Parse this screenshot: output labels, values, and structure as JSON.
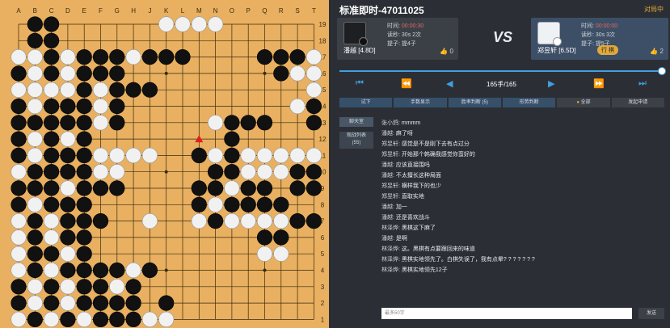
{
  "board": {
    "columns": [
      "A",
      "B",
      "C",
      "D",
      "E",
      "F",
      "G",
      "H",
      "J",
      "K",
      "L",
      "M",
      "N",
      "O",
      "P",
      "Q",
      "R",
      "S",
      "T"
    ],
    "rows": [
      "19",
      "18",
      "17",
      "16",
      "15",
      "14",
      "13",
      "12",
      "11",
      "10",
      "9",
      "8",
      "7",
      "6",
      "5",
      "4",
      "3",
      "2",
      "1"
    ],
    "stones": [
      ".xx......oooo......",
      ".xx.................",
      "ooxoxxxoxxx....xxxo..",
      "xoxoxxx.........xooo..",
      "ooooxoxxx.........ooox",
      "xoxxxox..........ox..x",
      "xxxxxox.....oxxx..xox",
      "xoxox........x.......",
      "xoxxxoooo..xoxoooooo.",
      "oxxxxoo.....xxoooxxo.",
      "xxxoxxx....xxoxx.xxx.",
      "xoxxx......xoxxxx....",
      "oxoxxx..o..oxooooxx..",
      "oxoxx..........xx....",
      "oxxox..........oo....",
      "oxoxxxxox.............",
      "xoxoxxox...........xo.",
      "xoxoxxxx.x...........",
      "oxoxoxxxoo..........."
    ],
    "last_move_marker": "red-triangle"
  },
  "header": {
    "title": "标准即时-47011025",
    "exit_label": "对局中"
  },
  "players": {
    "black": {
      "name": "潘越 [4.8D]",
      "time_label": "时间:",
      "time_value": "00:00:30",
      "byoyomi_label": "读秒:",
      "byoyomi_value": "30s 2次",
      "captures_label": "提子:",
      "captures_value": "提4子",
      "likes": "0"
    },
    "white": {
      "name": "郑昱轩 [6.5D]",
      "time_label": "时间:",
      "time_value": "00:00:00",
      "byoyomi_label": "读秒:",
      "byoyomi_value": "30s 3次",
      "captures_label": "提子:",
      "captures_value": "提5子",
      "badge": "行 棋",
      "likes": "2"
    }
  },
  "vs_label": "VS",
  "progress": {
    "current": 165,
    "total": 165
  },
  "move_counter": "165手/165",
  "toolbar": [
    "试下",
    "手数显示",
    "胜率判断 (5)",
    "形势判断",
    "全部",
    "发起申请"
  ],
  "side_tabs": {
    "chat": "聊天室",
    "viewers": "观战列表\n(55)"
  },
  "chat": [
    {
      "name": "张小鸽:",
      "msg": "mmmm"
    },
    {
      "name": "潘越:",
      "msg": "麻了呀"
    },
    {
      "name": "郑昱轩:",
      "msg": "感觉是不是刚下去有点过分"
    },
    {
      "name": "郑昱轩:",
      "msg": "开始那个韩确我感觉你蛮好的"
    },
    {
      "name": "潘越:",
      "msg": "应该直接围吗"
    },
    {
      "name": "潘越:",
      "msg": "不太擅长这种局面"
    },
    {
      "name": "郑昱轩:",
      "msg": "横样我下的也少"
    },
    {
      "name": "郑昱轩:",
      "msg": "直取实地"
    },
    {
      "name": "潘越:",
      "msg": "加一"
    },
    {
      "name": "潘越:",
      "msg": "还是喜欢战斗"
    },
    {
      "name": "林泽烨:",
      "msg": "黑棋这下麻了"
    },
    {
      "name": "潘越:",
      "msg": "是啊"
    },
    {
      "name": "林泽烨:",
      "msg": "这。黑棋有点要跟回来的味道"
    },
    {
      "name": "林泽烨:",
      "msg": "黑棋实地领先了。白棋失误了，我有点晕? ? ? ? ? ? ?"
    },
    {
      "name": "林泽烨:",
      "msg": "黑棋实地领先12子"
    }
  ],
  "input_placeholder": "最多50字",
  "send_label": "发送"
}
